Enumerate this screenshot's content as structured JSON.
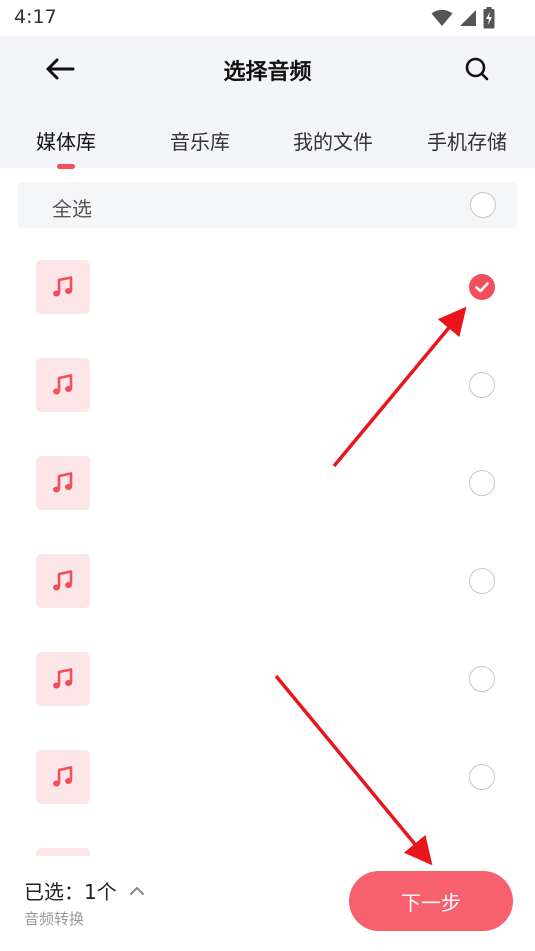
{
  "status_bar": {
    "time": "4:17",
    "icons": [
      "wifi-icon",
      "signal-icon",
      "battery-charging-icon"
    ]
  },
  "header": {
    "title": "选择音频",
    "back_icon": "back-arrow-icon",
    "search_icon": "search-icon"
  },
  "tabs": [
    {
      "label": "媒体库",
      "active": true
    },
    {
      "label": "音乐库",
      "active": false
    },
    {
      "label": "我的文件",
      "active": false
    },
    {
      "label": "手机存储",
      "active": false
    }
  ],
  "select_all": {
    "label": "全选",
    "checked": false
  },
  "audio_items": [
    {
      "icon": "music-note-icon",
      "checked": true
    },
    {
      "icon": "music-note-icon",
      "checked": false
    },
    {
      "icon": "music-note-icon",
      "checked": false
    },
    {
      "icon": "music-note-icon",
      "checked": false
    },
    {
      "icon": "music-note-icon",
      "checked": false
    },
    {
      "icon": "music-note-icon",
      "checked": false
    }
  ],
  "bottom_bar": {
    "selected_label": "已选：1个",
    "subtitle": "音频转换",
    "next_label": "下一步"
  },
  "colors": {
    "accent": "#f24e5c",
    "button": "#f6616d",
    "thumb_bg": "#fde6e8",
    "header_bg": "#f4f5f9",
    "annotation_arrow": "#e8161b"
  }
}
